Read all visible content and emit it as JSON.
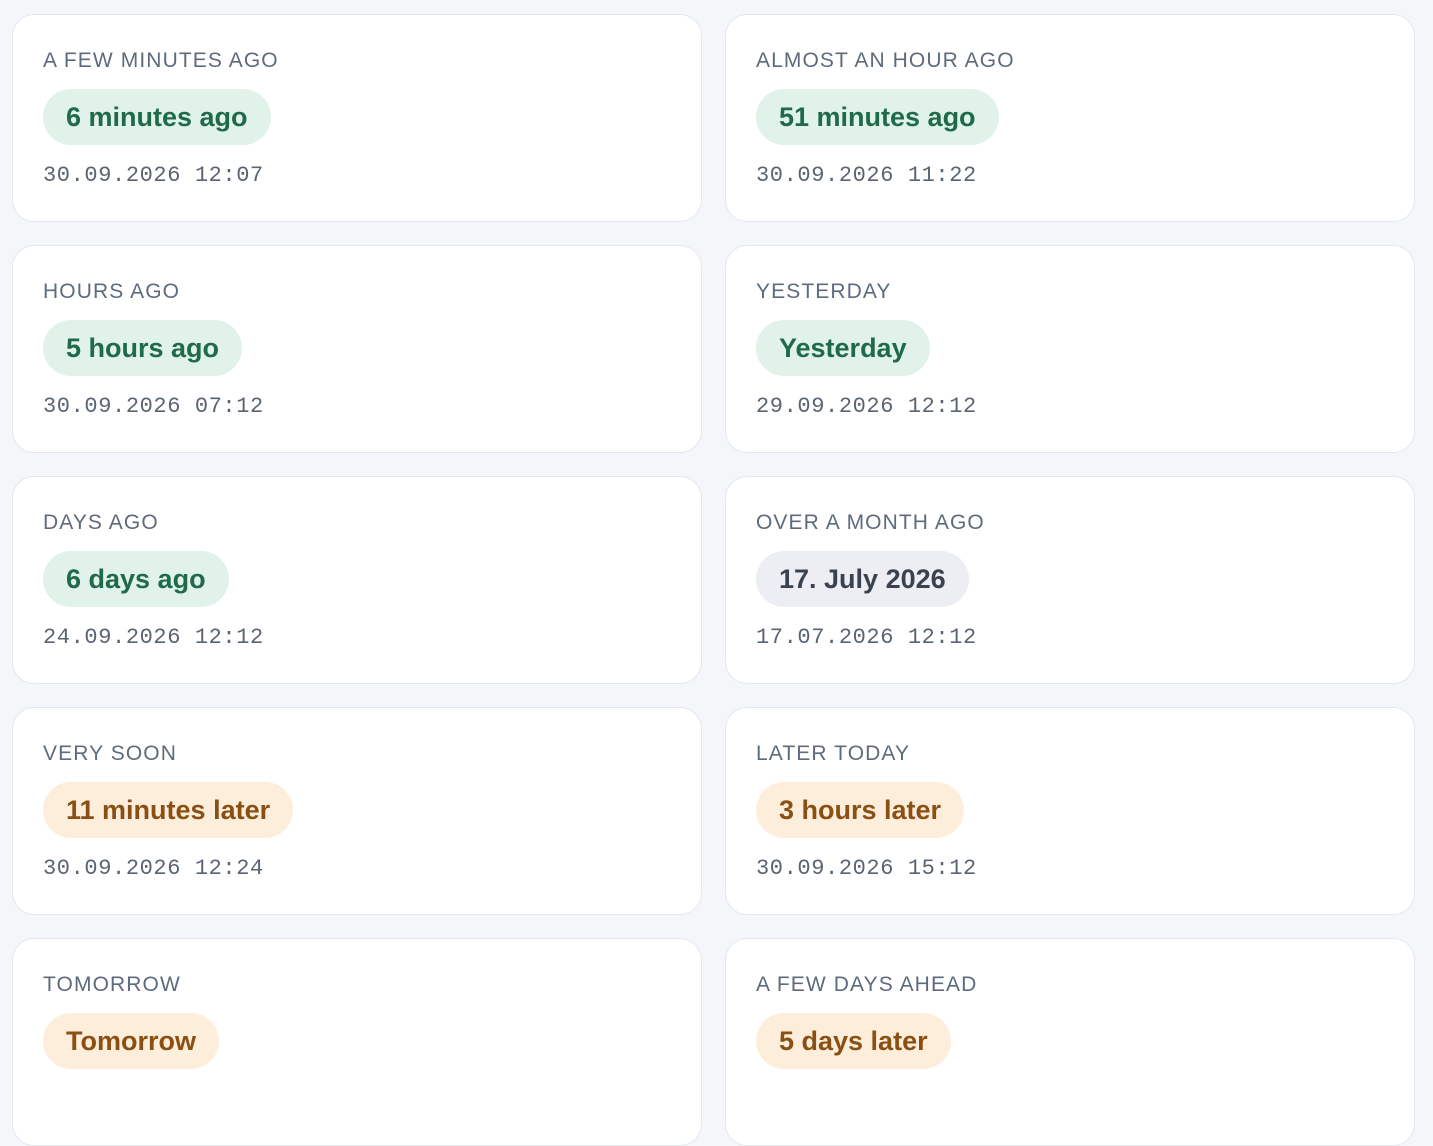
{
  "cards": [
    {
      "label": "A FEW MINUTES AGO",
      "badge": "6 minutes ago",
      "tone": "past",
      "timestamp": "30.09.2026 12:07"
    },
    {
      "label": "ALMOST AN HOUR AGO",
      "badge": "51 minutes ago",
      "tone": "past",
      "timestamp": "30.09.2026 11:22"
    },
    {
      "label": "HOURS AGO",
      "badge": "5 hours ago",
      "tone": "past",
      "timestamp": "30.09.2026 07:12"
    },
    {
      "label": "YESTERDAY",
      "badge": "Yesterday",
      "tone": "past",
      "timestamp": "29.09.2026 12:12"
    },
    {
      "label": "DAYS AGO",
      "badge": "6 days ago",
      "tone": "past",
      "timestamp": "24.09.2026 12:12"
    },
    {
      "label": "OVER A MONTH AGO",
      "badge": "17. July 2026",
      "tone": "neutral",
      "timestamp": "17.07.2026 12:12"
    },
    {
      "label": "VERY SOON",
      "badge": "11 minutes later",
      "tone": "future",
      "timestamp": "30.09.2026 12:24"
    },
    {
      "label": "LATER TODAY",
      "badge": "3 hours later",
      "tone": "future",
      "timestamp": "30.09.2026 15:12"
    },
    {
      "label": "TOMORROW",
      "badge": "Tomorrow",
      "tone": "future",
      "timestamp": ""
    },
    {
      "label": "A FEW DAYS AHEAD",
      "badge": "5 days later",
      "tone": "future",
      "timestamp": ""
    }
  ],
  "colors": {
    "page_background": "#f4f6fa",
    "card_background": "#ffffff",
    "past_badge_bg": "#e0f2ea",
    "past_badge_text": "#1f6a49",
    "neutral_badge_bg": "#eceef3",
    "neutral_badge_text": "#3a4250",
    "future_badge_bg": "#fdeedc",
    "future_badge_text": "#8a4f12"
  }
}
